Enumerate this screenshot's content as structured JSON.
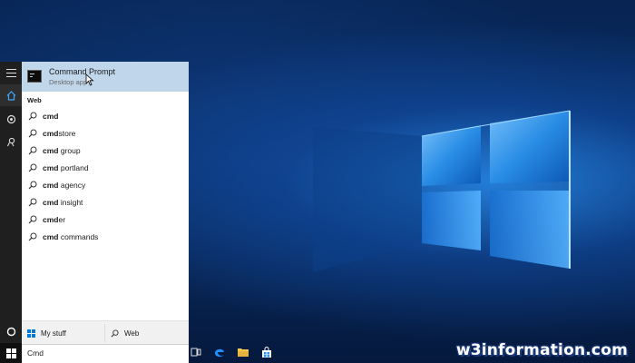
{
  "top_result": {
    "title": "Command Prompt",
    "subtitle": "Desktop app"
  },
  "section_label": "Web",
  "suggestions": [
    {
      "bold": "cmd",
      "rest": ""
    },
    {
      "bold": "cmd",
      "rest": "store"
    },
    {
      "bold": "cmd",
      "rest": " group"
    },
    {
      "bold": "cmd",
      "rest": " portland"
    },
    {
      "bold": "cmd",
      "rest": " agency"
    },
    {
      "bold": "cmd",
      "rest": " insight"
    },
    {
      "bold": "cmd",
      "rest": "er"
    },
    {
      "bold": "cmd",
      "rest": " commands"
    }
  ],
  "bottom_bar": {
    "my_stuff_label": "My stuff",
    "web_label": "Web"
  },
  "search": {
    "value": "Cmd"
  },
  "watermark": "w3information.com",
  "icons": {
    "rail": [
      "hamburger-icon",
      "home-icon",
      "settings-icon",
      "feedback-icon",
      "cortana-circle-icon"
    ],
    "taskbar": [
      "task-view-icon",
      "edge-icon",
      "file-explorer-icon",
      "store-icon"
    ]
  },
  "colors": {
    "selected_result": "#c0d6ea",
    "rail": "#1f1f1f",
    "accent": "#0078d7"
  }
}
